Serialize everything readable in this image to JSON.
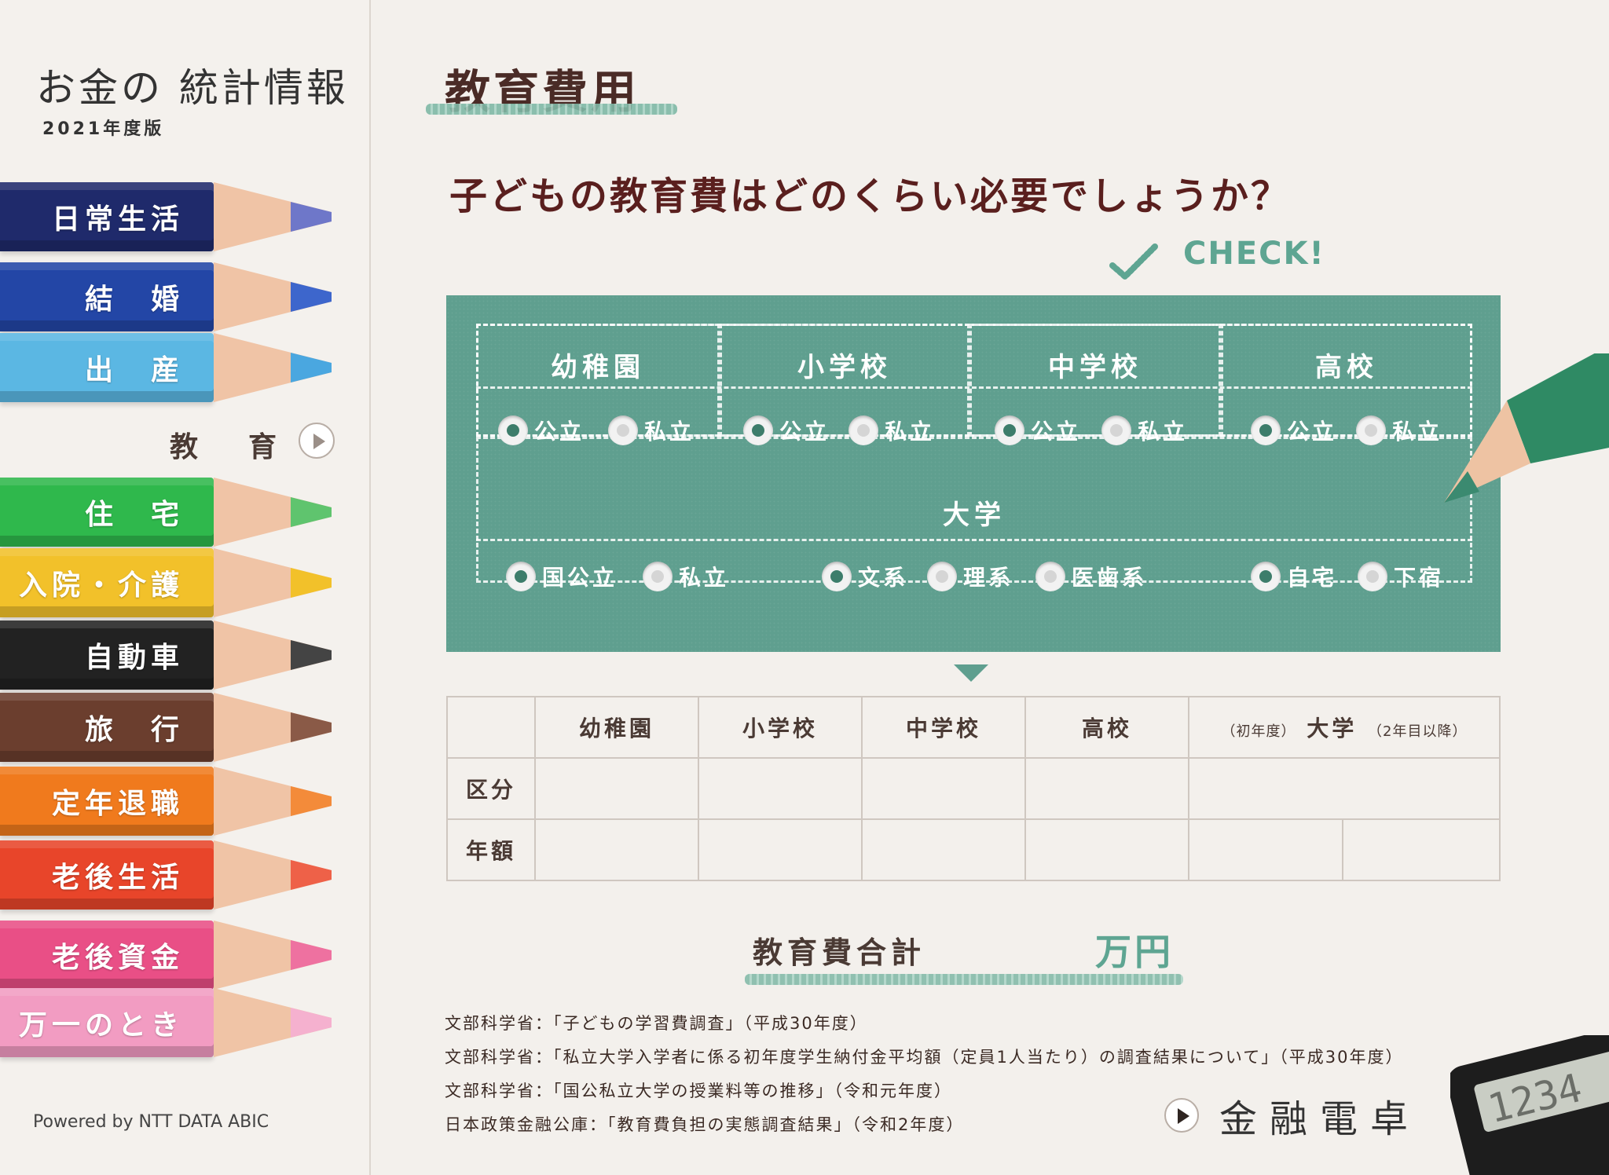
{
  "sidebar": {
    "brand_title": "お金の 統計情報",
    "brand_edition": "2021年度版",
    "items": [
      {
        "label": "日常生活",
        "color": "#1f2a6b",
        "tipcolor": "#6e77c9"
      },
      {
        "label": "結　婚",
        "color": "#2346a6",
        "tipcolor": "#3d66cc"
      },
      {
        "label": "出　産",
        "color": "#5bb7e3",
        "tipcolor": "#4aa7e0"
      },
      {
        "label": "住　宅",
        "color": "#2fb84c",
        "tipcolor": "#5fc46e"
      },
      {
        "label": "入院・介護",
        "color": "#f2c12a",
        "tipcolor": "#f2c12a"
      },
      {
        "label": "自動車",
        "color": "#222222",
        "tipcolor": "#444444"
      },
      {
        "label": "旅　行",
        "color": "#6b3e2e",
        "tipcolor": "#8a5a47"
      },
      {
        "label": "定年退職",
        "color": "#f07a1d",
        "tipcolor": "#f38b3a"
      },
      {
        "label": "老後生活",
        "color": "#e8452a",
        "tipcolor": "#ee6148"
      },
      {
        "label": "老後資金",
        "color": "#e94f86",
        "tipcolor": "#ee71a0"
      },
      {
        "label": "万一のとき",
        "color": "#f29cc2",
        "tipcolor": "#f5b1cf"
      }
    ],
    "current_label": "教　育",
    "powered_by": "Powered by NTT DATA ABIC"
  },
  "main": {
    "page_title": "教育費用",
    "question": "子どもの教育費はどのくらい必要でしょうか？",
    "check_label": "CHECK!",
    "board": {
      "schools": [
        "幼稚園",
        "小学校",
        "中学校",
        "高校"
      ],
      "public_label": "公立",
      "private_label": "私立",
      "university": "大学",
      "uni_options": [
        "国公立",
        "私立",
        "文系",
        "理系",
        "医歯系",
        "自宅",
        "下宿"
      ]
    },
    "table": {
      "headers": [
        "幼稚園",
        "小学校",
        "中学校",
        "高校"
      ],
      "uni_header": "大学",
      "uni_first": "（初年度）",
      "uni_later": "（2年目以降）",
      "row1": "区分",
      "row2": "年額"
    },
    "total_label": "教育費合計",
    "total_unit": "万円",
    "sources": [
      "文部科学省：「子どもの学習費調査」（平成30年度）",
      "文部科学省：「私立大学入学者に係る初年度学生納付金平均額（定員1人当たり）の調査結果について」（平成30年度）",
      "文部科学省：「国公私立大学の授業料等の推移」（令和元年度）",
      "日本政策金融公庫：「教育費負担の実態調査結果」（令和2年度）"
    ],
    "calc_label": "金融電卓",
    "calc_display": "1234"
  }
}
